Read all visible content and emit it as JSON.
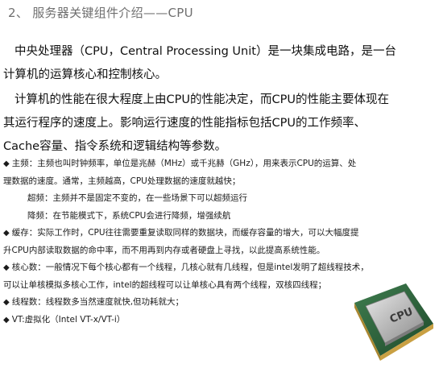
{
  "title": "2、 服务器关键组件介绍——CPU",
  "intro": {
    "line1": "中央处理器（CPU，Central Processing Unit）是一块集成电路，是一台",
    "line2": "计算机的运算核心和控制核心。",
    "line3": "计算机的性能在很大程度上由CPU的性能决定，而CPU的性能主要体现在",
    "line4": "其运行程序的速度上。影响运行速度的性能指标包括CPU的工作频率、",
    "line5": "Cache容量、指令系统和逻辑结构等参数。"
  },
  "bullets": {
    "symbol": "◆",
    "freq1": "主频：主频也叫时钟频率，单位是兆赫（MHz）或千兆赫（GHz），用来表示CPU的运算、处",
    "freq2": "理数据的速度。通常，主频越高，CPU处理数据的速度就越快；",
    "turbo": "超频：主频并不是固定不变的，在一些场景下可以超频运行",
    "down": "降频：在节能模式下，系统CPU会进行降频，增强续航",
    "cache1": "缓存：实际工作时，CPU往往需要重复读取同样的数据块，而缓存容量的增大，可以大幅度提",
    "cache2": "升CPU内部读取数据的命中率，而不用再到内存或者硬盘上寻找，以此提高系统性能。",
    "cores1": "核心数：一般情况下每个核心都有一个线程，几核心就有几线程，但是intel发明了超线程技术，",
    "cores2": "可以让单核模拟多核心工作，intel的超线程可以让单核心具有两个线程，双核四线程；",
    "threads": "线程数：线程数多当然速度就快,但功耗就大；",
    "vt": "VT:虚拟化（Intel VT-x/VT-i）"
  },
  "cpu_chip_label": "CPU",
  "colors": {
    "title": "#6f6f6f",
    "text": "#111111",
    "chip_gold": "#c9a043",
    "chip_green": "#2f6b3f"
  }
}
